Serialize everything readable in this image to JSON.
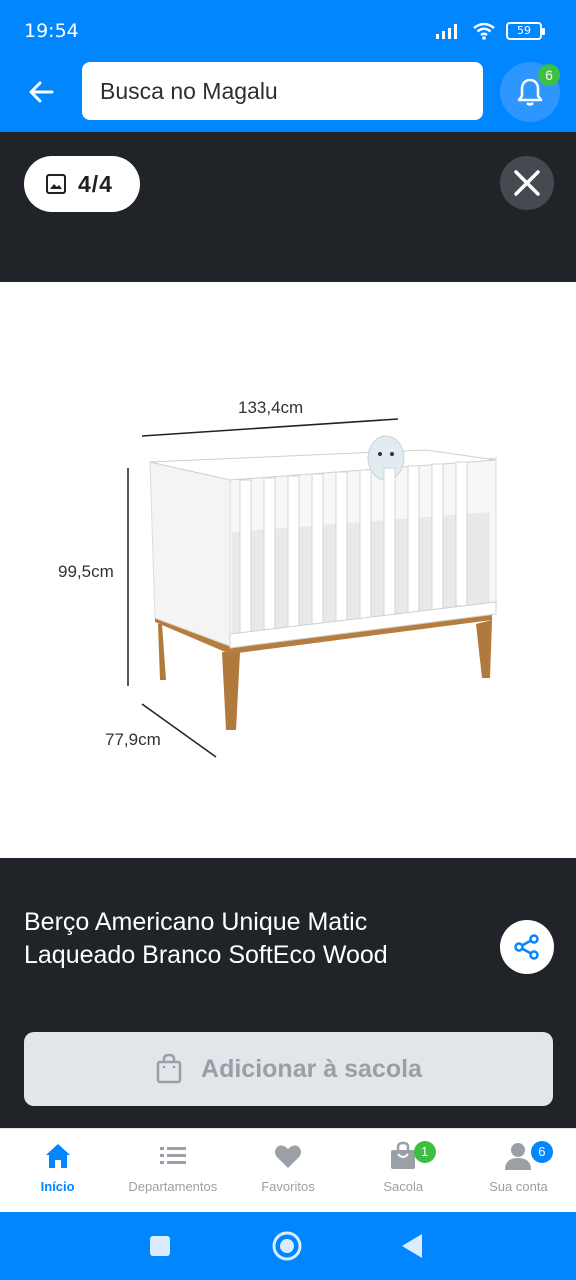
{
  "status_bar": {
    "time": "19:54",
    "battery": "59"
  },
  "header": {
    "search_placeholder": "Busca no Magalu",
    "notification_count": "6"
  },
  "gallery": {
    "counter": "4/4",
    "dimensions": {
      "width": "133,4cm",
      "height": "99,5cm",
      "depth": "77,9cm"
    }
  },
  "product": {
    "title": "Berço Americano Unique Matic Laqueado Branco SoftEco Wood",
    "add_to_bag_label": "Adicionar à sacola"
  },
  "bottom_nav": {
    "items": [
      {
        "label": "Início",
        "icon": "home-icon",
        "active": true
      },
      {
        "label": "Departamentos",
        "icon": "list-icon",
        "active": false
      },
      {
        "label": "Favoritos",
        "icon": "heart-icon",
        "active": false
      },
      {
        "label": "Sacola",
        "icon": "bag-icon",
        "active": false,
        "badge": "1"
      },
      {
        "label": "Sua conta",
        "icon": "user-icon",
        "active": false,
        "badge": "6"
      }
    ]
  },
  "colors": {
    "brand_blue": "#0086ff",
    "dark_bg": "#202428",
    "badge_green": "#3dbf42",
    "badge_blue": "#0086ff"
  }
}
